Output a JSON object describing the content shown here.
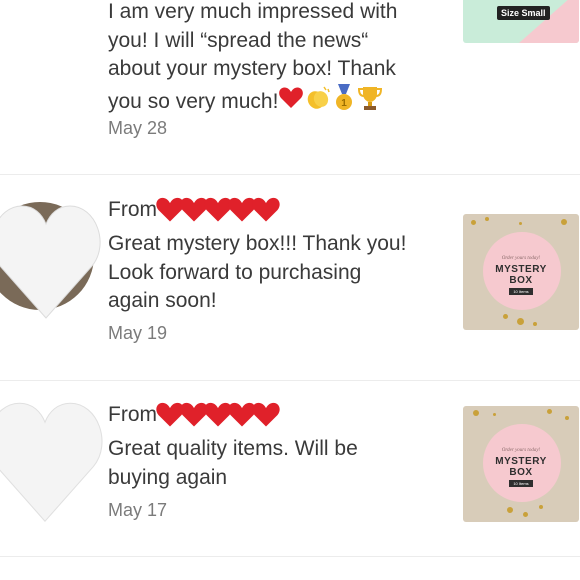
{
  "reviews": [
    {
      "lines": [
        "I am very much impressed with",
        "you! I will “spread the news“",
        "about your mystery box! Thank",
        "you so very much!"
      ],
      "date": "May 28",
      "badge": "Size Small"
    },
    {
      "from_label": "From",
      "lines": [
        "Great mystery box!!! Thank you!",
        "Look forward to purchasing",
        "again soon!"
      ],
      "date": "May 19",
      "thumb": {
        "small": "Order yours today!",
        "title_1": "MYSTERY",
        "title_2": "BOX",
        "tag": "10 Items"
      }
    },
    {
      "from_label": "From",
      "lines": [
        "Great quality items. Will be",
        "buying again"
      ],
      "date": "May 17",
      "thumb": {
        "small": "Order yours today!",
        "title_1": "MYSTERY",
        "title_2": "BOX",
        "tag": "10 Items"
      }
    }
  ],
  "colors": {
    "heart": "#e0212a",
    "avatar_heart": "#f4f4f4",
    "thumb_pink": "#f6c9cf",
    "thumb_bg": "#d8ccb9"
  },
  "icons": [
    "heart-emoji-icon",
    "clapping-hands-icon",
    "gold-medal-icon",
    "trophy-icon",
    "white-heart-icon"
  ]
}
